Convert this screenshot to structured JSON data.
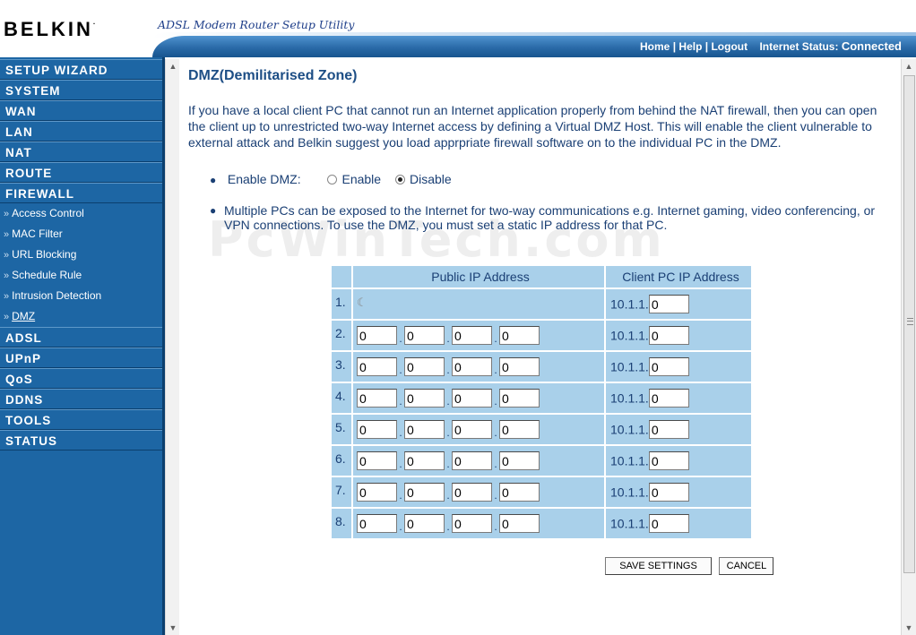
{
  "header": {
    "brand": "BELKIN",
    "brand_mark": ".",
    "utility_title": "ADSL Modem Router Setup Utility",
    "links": {
      "home": "Home",
      "help": "Help",
      "logout": "Logout",
      "sep": "|",
      "status_label": "Internet Status:",
      "status_value": "Connected"
    },
    "colors": {
      "status_connected": "#33ff33",
      "bar": "#2a6aa8"
    }
  },
  "sidebar": {
    "colors": {
      "background": "#1d66a4"
    },
    "sections_top": [
      "SETUP WIZARD",
      "SYSTEM",
      "WAN",
      "LAN",
      "NAT",
      "ROUTE",
      "FIREWALL"
    ],
    "firewall_items": [
      "Access Control",
      "MAC Filter",
      "URL Blocking",
      "Schedule Rule",
      "Intrusion Detection",
      "DMZ"
    ],
    "sections_bottom": [
      "ADSL",
      "UPnP",
      "QoS",
      "DDNS",
      "TOOLS",
      "STATUS"
    ],
    "sub_arrow": "»",
    "active_item": "DMZ"
  },
  "main": {
    "title": "DMZ(Demilitarised Zone)",
    "intro": "If you have a local client PC that cannot run an Internet application properly from behind the NAT firewall, then you can open the client up to unrestricted two-way Internet access by defining a Virtual DMZ Host. This will enable the client vulnerable to external attack and Belkin suggest you load apprpriate firewall software on to the individual PC in the DMZ.",
    "enable_dmz": {
      "label": "Enable DMZ:",
      "enable_label": "Enable",
      "disable_label": "Disable",
      "selected": "Disable"
    },
    "multi_text": "Multiple PCs can be exposed to the Internet for two-way communications e.g. Internet gaming, video conferencing, or VPN connections.  To use the DMZ, you must set a static IP address for that PC.",
    "table": {
      "col_public": "Public IP Address",
      "col_client": "Client PC IP Address",
      "client_prefix": "10.1.1.",
      "dot": ".",
      "rows": [
        {
          "num": "1.",
          "public": null,
          "client": "0"
        },
        {
          "num": "2.",
          "public": [
            "0",
            "0",
            "0",
            "0"
          ],
          "client": "0"
        },
        {
          "num": "3.",
          "public": [
            "0",
            "0",
            "0",
            "0"
          ],
          "client": "0"
        },
        {
          "num": "4.",
          "public": [
            "0",
            "0",
            "0",
            "0"
          ],
          "client": "0"
        },
        {
          "num": "5.",
          "public": [
            "0",
            "0",
            "0",
            "0"
          ],
          "client": "0"
        },
        {
          "num": "6.",
          "public": [
            "0",
            "0",
            "0",
            "0"
          ],
          "client": "0"
        },
        {
          "num": "7.",
          "public": [
            "0",
            "0",
            "0",
            "0"
          ],
          "client": "0"
        },
        {
          "num": "8.",
          "public": [
            "0",
            "0",
            "0",
            "0"
          ],
          "client": "0"
        }
      ]
    },
    "buttons": {
      "save": "SAVE SETTINGS",
      "cancel": "CANCEL"
    }
  },
  "watermark": "PcWinTech.com"
}
